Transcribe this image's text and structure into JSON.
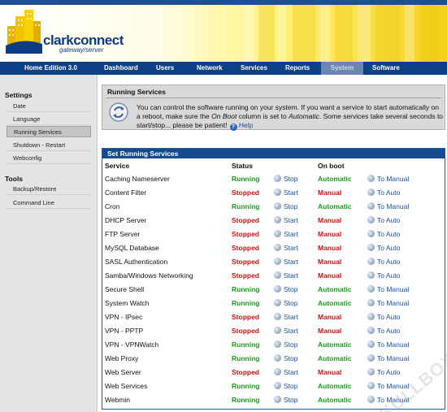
{
  "header": {
    "logo_text": "clarkconnect",
    "logo_sub": "gateway/server"
  },
  "nav": {
    "edition": "Home Edition 3.0",
    "items": [
      {
        "label": "Dashboard"
      },
      {
        "label": "Users"
      },
      {
        "label": "Network"
      },
      {
        "label": "Services"
      },
      {
        "label": "Reports"
      },
      {
        "label": "System",
        "active": true
      },
      {
        "label": "Software"
      }
    ]
  },
  "sidebar": {
    "settings_heading": "Settings",
    "settings_items": [
      {
        "label": "Date"
      },
      {
        "label": "Language"
      },
      {
        "label": "Running Services",
        "active": true
      },
      {
        "label": "Shutdown - Restart"
      },
      {
        "label": "Webconfig"
      }
    ],
    "tools_heading": "Tools",
    "tools_items": [
      {
        "label": "Backup/Restore"
      },
      {
        "label": "Command Line"
      }
    ]
  },
  "running_services": {
    "title": "Running Services",
    "text_1": "You can control the software running on your system.  If you want a service to start automatically on a reboot, make sure the ",
    "text_em1": "On Boot",
    "text_2": " column is set to ",
    "text_em2": "Automatic",
    "text_3": ".  Some services take several seconds to start/stop... please be patient!",
    "help_label": "Help"
  },
  "set_services": {
    "title": "Set Running Services",
    "columns": {
      "service": "Service",
      "status": "Status",
      "on_boot": "On boot"
    },
    "rows": [
      {
        "name": "Caching Nameserver",
        "status": "Running",
        "action": "Stop",
        "boot": "Automatic",
        "boot_action": "To Manual"
      },
      {
        "name": "Content Filter",
        "status": "Stopped",
        "action": "Start",
        "boot": "Manual",
        "boot_action": "To Auto"
      },
      {
        "name": "Cron",
        "status": "Running",
        "action": "Stop",
        "boot": "Automatic",
        "boot_action": "To Manual"
      },
      {
        "name": "DHCP Server",
        "status": "Stopped",
        "action": "Start",
        "boot": "Manual",
        "boot_action": "To Auto"
      },
      {
        "name": "FTP Server",
        "status": "Stopped",
        "action": "Start",
        "boot": "Manual",
        "boot_action": "To Auto"
      },
      {
        "name": "MySQL Database",
        "status": "Stopped",
        "action": "Start",
        "boot": "Manual",
        "boot_action": "To Auto"
      },
      {
        "name": "SASL Authentication",
        "status": "Stopped",
        "action": "Start",
        "boot": "Manual",
        "boot_action": "To Auto"
      },
      {
        "name": "Samba/Windows Networking",
        "status": "Stopped",
        "action": "Start",
        "boot": "Manual",
        "boot_action": "To Auto"
      },
      {
        "name": "Secure Shell",
        "status": "Running",
        "action": "Stop",
        "boot": "Automatic",
        "boot_action": "To Manual"
      },
      {
        "name": "System Watch",
        "status": "Running",
        "action": "Stop",
        "boot": "Automatic",
        "boot_action": "To Manual"
      },
      {
        "name": "VPN - IPsec",
        "status": "Stopped",
        "action": "Start",
        "boot": "Manual",
        "boot_action": "To Auto"
      },
      {
        "name": "VPN - PPTP",
        "status": "Stopped",
        "action": "Start",
        "boot": "Manual",
        "boot_action": "To Auto"
      },
      {
        "name": "VPN - VPNWatch",
        "status": "Running",
        "action": "Stop",
        "boot": "Automatic",
        "boot_action": "To Manual"
      },
      {
        "name": "Web Proxy",
        "status": "Running",
        "action": "Stop",
        "boot": "Automatic",
        "boot_action": "To Manual"
      },
      {
        "name": "Web Server",
        "status": "Stopped",
        "action": "Start",
        "boot": "Manual",
        "boot_action": "To Auto"
      },
      {
        "name": "Web Services",
        "status": "Running",
        "action": "Stop",
        "boot": "Automatic",
        "boot_action": "To Manual"
      },
      {
        "name": "Webmin",
        "status": "Running",
        "action": "Stop",
        "boot": "Automatic",
        "boot_action": "To Manual"
      }
    ]
  },
  "watermark": "SKULLBOX.NET",
  "colors": {
    "nav_blue": "#0d4187",
    "running": "#1a9a1a",
    "stopped": "#cc1111",
    "link": "#1b4fa0"
  }
}
